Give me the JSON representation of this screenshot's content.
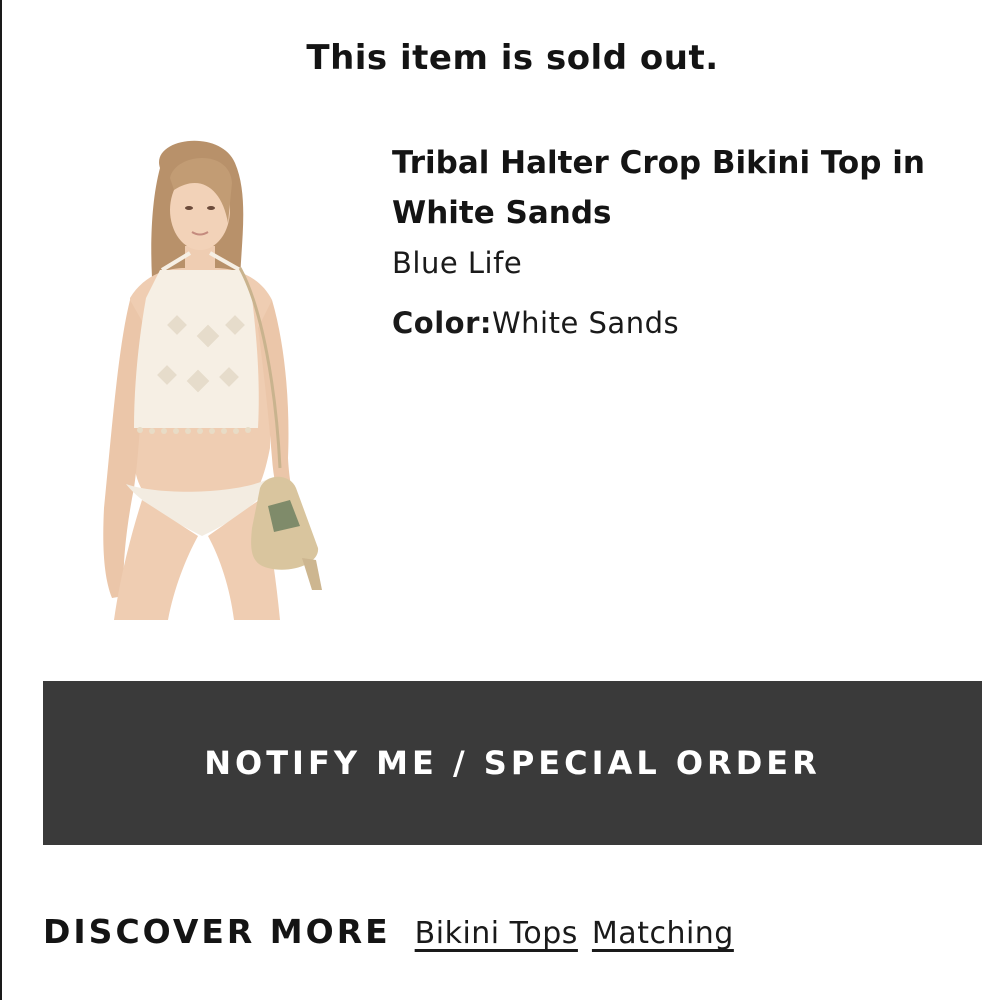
{
  "notice": {
    "sold_out": "This item is sold out."
  },
  "product": {
    "name": "Tribal Halter Crop Bikini Top in White Sands",
    "brand": "Blue Life",
    "color_label": "Color:",
    "color_value": "White Sands",
    "image_icon": "product-photo"
  },
  "actions": {
    "notify_label": "NOTIFY ME / SPECIAL ORDER"
  },
  "discover": {
    "label": "DISCOVER MORE",
    "links": [
      "Bikini Tops",
      "Matching"
    ]
  },
  "colors": {
    "button_bg": "#3a3a3a",
    "text": "#141414",
    "background": "#ffffff"
  }
}
